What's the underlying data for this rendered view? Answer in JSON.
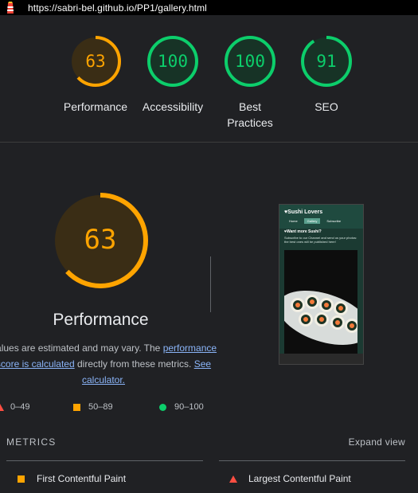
{
  "browser": {
    "url": "https://sabri-bel.github.io/PP1/gallery.html"
  },
  "summary_scores": [
    {
      "label": "Performance",
      "score": "63",
      "color": "#ffa400",
      "fraction": 0.63
    },
    {
      "label": "Accessibility",
      "score": "100",
      "color": "#0cce6b",
      "fraction": 1.0
    },
    {
      "label": "Best Practices",
      "score": "100",
      "color": "#0cce6b",
      "fraction": 1.0
    },
    {
      "label": "SEO",
      "score": "91",
      "color": "#0cce6b",
      "fraction": 0.91
    }
  ],
  "performance": {
    "score": "63",
    "fraction": 0.63,
    "title": "Performance",
    "desc_prefix": "Values are estimated and may vary. The",
    "desc_link": "performance score is calculated",
    "desc_middle": "directly from these metrics.",
    "desc_calc_link": "See calculator."
  },
  "legend": {
    "fail": "0–49",
    "average": "50–89",
    "pass": "90–100"
  },
  "screenshot": {
    "brand": "♥Sushi Lovers",
    "nav": [
      "Home",
      "Gallery",
      "Subscribe"
    ],
    "promo_title": "♥Want more Sushi?",
    "promo_text": "Subscribe to our Channel and send us your photos: the best ones will be published here!"
  },
  "metrics": {
    "heading": "METRICS",
    "expand": "Expand view",
    "items": [
      {
        "label": "First Contentful Paint",
        "status": "average",
        "color": "#ffa400"
      },
      {
        "label": "Largest Contentful Paint",
        "status": "fail",
        "color": "#ff4e42"
      }
    ]
  },
  "colors": {
    "average": "#ffa400",
    "pass": "#0cce6b",
    "fail": "#ff4e42",
    "background": "#202124"
  }
}
